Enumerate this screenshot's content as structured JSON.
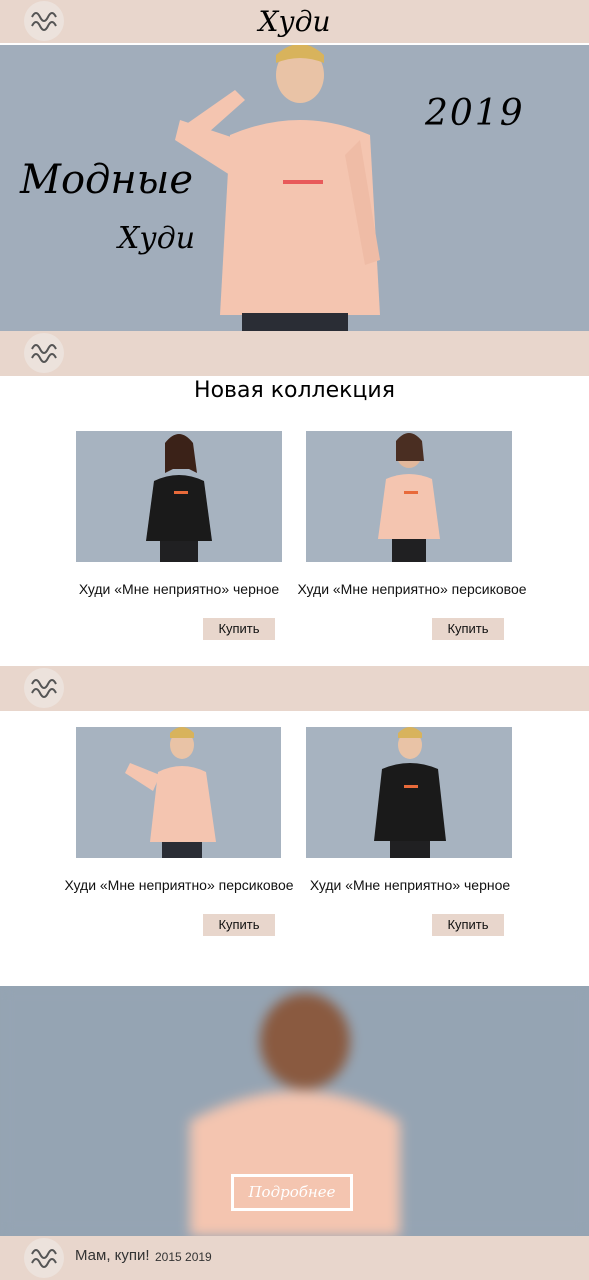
{
  "header": {
    "title": "Худи",
    "logo_icon": "mam-kupi-logo"
  },
  "hero": {
    "line1": "Модные",
    "line2": "Худи",
    "year": "2019"
  },
  "section1": {
    "title": "Новая коллекция",
    "products": [
      {
        "title": "Худи «Мне неприятно» черное",
        "button": "Купить"
      },
      {
        "title": "Худи «Мне неприятно» персиковое",
        "button": "Купить"
      }
    ]
  },
  "section2": {
    "products": [
      {
        "title": "Худи «Мне неприятно» персиковое",
        "button": "Купить"
      },
      {
        "title": "Худи «Мне неприятно» черное",
        "button": "Купить"
      }
    ]
  },
  "banner": {
    "button": "Подробнее"
  },
  "footer": {
    "brand": "Мам, купи!",
    "years": "2015 2019"
  },
  "colors": {
    "band": "#e8d6cc",
    "hero_bg": "#a1adbb",
    "peach": "#f4c5b0",
    "black_hoodie": "#1a1a1a"
  }
}
